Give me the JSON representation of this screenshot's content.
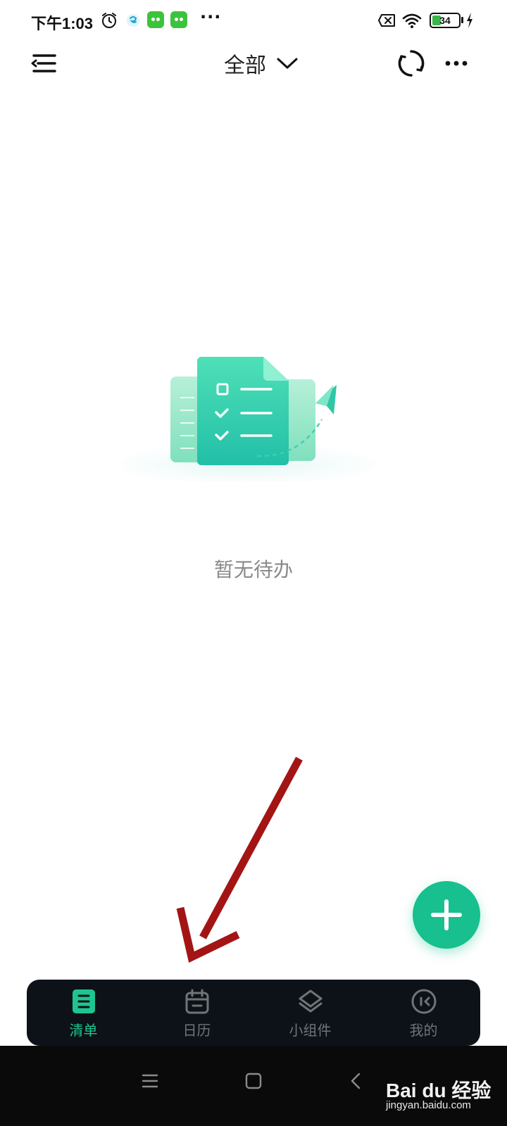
{
  "status_bar": {
    "time": "下午1:03",
    "more_indicator": "···",
    "battery_level": 34,
    "battery_text": "34",
    "icons": [
      "alarm-icon",
      "app-notification-icon",
      "app-badge-icon",
      "app-badge-icon",
      "sim-x-icon",
      "wifi-icon",
      "battery-icon",
      "charging-icon"
    ]
  },
  "header": {
    "title": "全部",
    "menu_icon": "menu-collapse-icon",
    "dropdown_icon": "chevron-down-icon",
    "sync_icon": "sync-icon",
    "more_icon": "more-horizontal-icon"
  },
  "empty_state": {
    "message": "暂无待办",
    "illustration_icon": "checklist-paper-plane-illustration"
  },
  "fab": {
    "icon": "plus-icon"
  },
  "bottom_nav": {
    "items": [
      {
        "label": "清单",
        "icon": "list-icon",
        "active": true
      },
      {
        "label": "日历",
        "icon": "calendar-icon",
        "active": false
      },
      {
        "label": "小组件",
        "icon": "layers-icon",
        "active": false
      },
      {
        "label": "我的",
        "icon": "profile-icon",
        "active": false
      }
    ]
  },
  "system_nav": {
    "icons": [
      "recent-apps-icon",
      "home-icon",
      "back-icon"
    ]
  },
  "watermark": {
    "main": "Bai du 经验",
    "sub": "jingyan.baidu.com"
  },
  "colors": {
    "accent": "#17c08e",
    "nav_background": "#0c1217",
    "nav_inactive": "#6f7478",
    "annotation_arrow": "#a31515",
    "empty_text": "#8a8a8a"
  }
}
